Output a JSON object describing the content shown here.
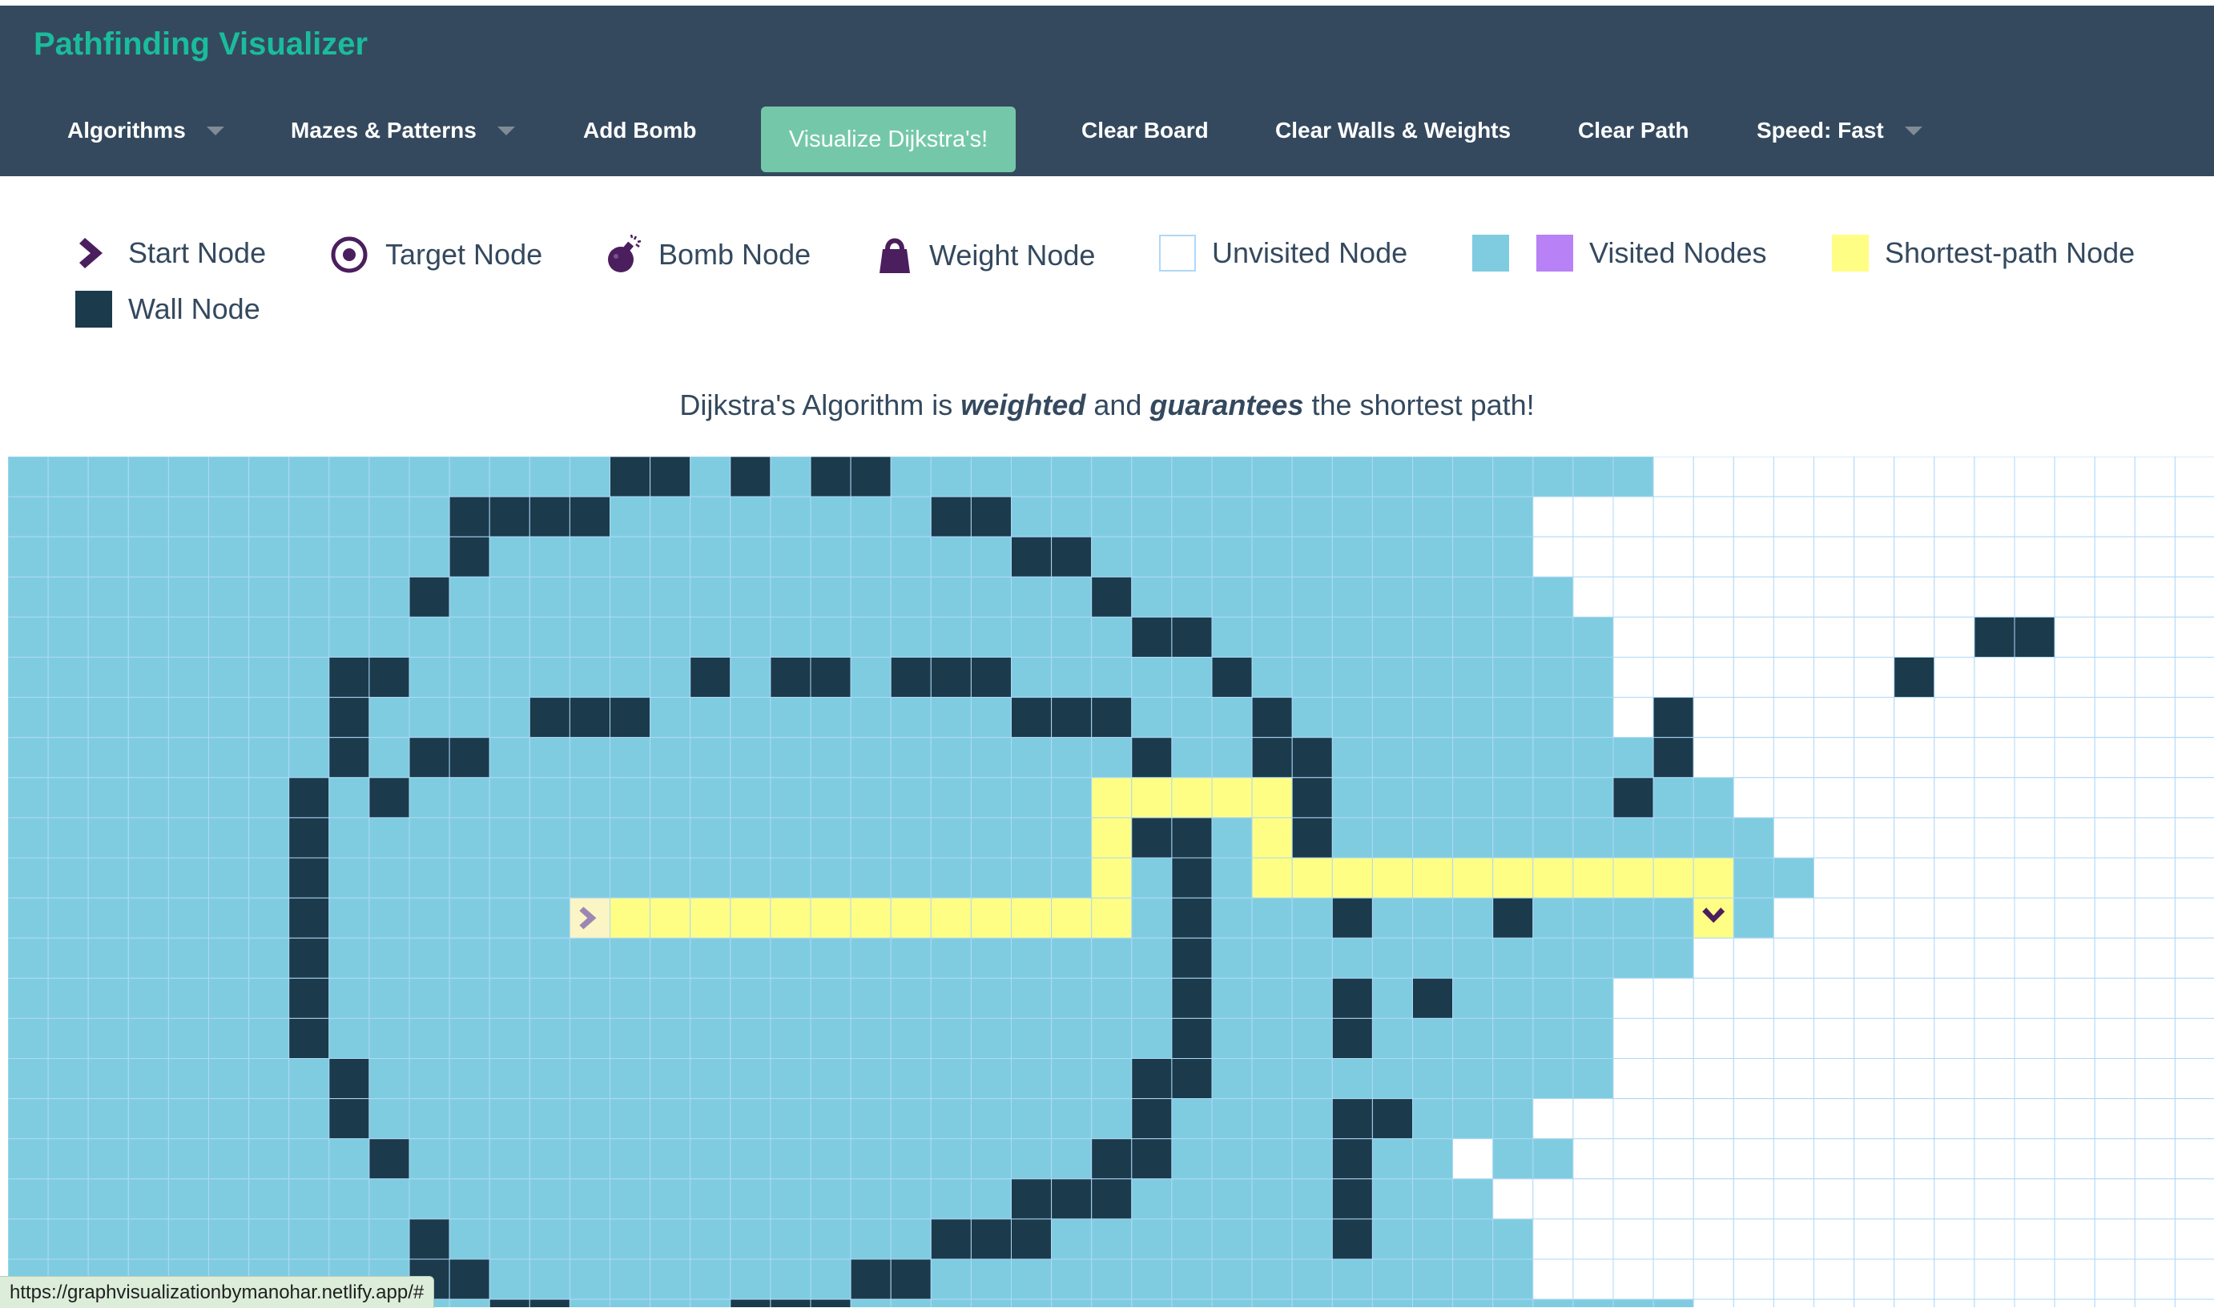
{
  "app": {
    "title": "Pathfinding Visualizer"
  },
  "navbar": {
    "items": [
      {
        "label": "Algorithms",
        "dropdown": true
      },
      {
        "label": "Mazes & Patterns",
        "dropdown": true
      },
      {
        "label": "Add Bomb",
        "dropdown": false
      },
      {
        "label": "Visualize Dijkstra's!",
        "primary": true
      },
      {
        "label": "Clear Board",
        "dropdown": false
      },
      {
        "label": "Clear Walls & Weights",
        "dropdown": false
      },
      {
        "label": "Clear Path",
        "dropdown": false
      },
      {
        "label": "Speed: Fast",
        "dropdown": true
      }
    ]
  },
  "legend": {
    "start": "Start Node",
    "target": "Target Node",
    "bomb": "Bomb Node",
    "weight": "Weight Node",
    "unvisited": "Unvisited Node",
    "visited": "Visited Nodes",
    "shortest": "Shortest-path Node",
    "wall": "Wall Node"
  },
  "info": {
    "prefix": "Dijkstra's Algorithm is ",
    "em1": "weighted",
    "middle": " and ",
    "em2": "guarantees",
    "suffix": " the shortest path!"
  },
  "colors": {
    "navbar": "#34495e",
    "brand": "#1abc9c",
    "visualize_button": "#74c8a9",
    "visited": "#7fcce0",
    "visited_purple": "#b881f5",
    "shortest_path": "#fffe84",
    "wall": "#1b3a4b",
    "unvisited_border": "#afd8f8",
    "start_target_icon": "#4b1e5e"
  },
  "grid": {
    "rows": 22,
    "cols": 55,
    "start": [
      11,
      14
    ],
    "target": [
      11,
      42
    ],
    "row_data": [
      "VVVVVVVVVVVVVVV##V#V##VVVVVVVVVVVVVVVVVVV..............",
      "VVVVVVVVVVV####VVVVVVVV##VVVVVVVVVVVVV.................",
      "VVVVVVVVVVV#VVVVVVVVVVVVV##VVVVVVVVVVV..................",
      "VVVVVVVVVV#VVVVVVVVVVVVVVVV#VVVVVVVVVVV.................",
      "VVVVVVVVVVVVVVVVVVVVVVVVVVVV##VVVVVVVVVV.........##.....",
      "VVVVVVVV##VVVVVVV#V##V###VVVVV#VVVVVVVVV.......#........",
      "VVVVVVVV#VVVV###VVVVVVVVV###VVV#VVVVVVVV.#..............",
      "VVVVVVVV#V##VVVVVVVVVVVVVVVV#VV##VVVVVVVV#..............",
      "VVVVVVV#V#VVVVVVVVVVVVVVVVVSSSSS#VVVVVVV#VV.............",
      "VVVVVVV#VVVVVVVVVVVVVVVVVVVS##VS#VVVVVVVVVVV............",
      "VVVVVVV#VVVVVVVVVVVVVVVVVVVSV#VSSSSSSSSSSSSVV...........",
      "VVVVVVV#VVVVVVSSSSSSSSSSSSSSV#VVV#VVV#VVVVSV............",
      "VVVVVVV#VVVVVVVVVVVVVVVVVVVVV#VVVVVVVVVVVV.............",
      "VVVVVVV#VVVVVVVVVVVVVVVVVVVVV#VVV#V#VVVV...............",
      "VVVVVVV#VVVVVVVVVVVVVVVVVVVVV#VVV#VVVVVV...............",
      "VVVVVVVV#VVVVVVVVVVVVVVVVVVV##VVVVVVVVVV...............",
      "VVVVVVVV#VVVVVVVVVVVVVVVVVVV#VVVV##VVV.................",
      "VVVVVVVVV#VVVVVVVVVVVVVVVVV##VVVV#VV.VV................",
      "VVVVVVVVVVVVVVVVVVVVVVVVV###VVVVV#VVV..................",
      "VVVVVVVVVV#VVVVVVVVVVVV###VVVVVVV#VVVV.................",
      "VVVVVVVVVV##VVVVVVVVV##VVVVVVVVVVVVVVV.................",
      "VVVVVVVVVVVV##VVVV###VVVVVVVVVVVVVVVVVVVVV............."
    ]
  },
  "status_url": "https://graphvisualizationbymanohar.netlify.app/#"
}
